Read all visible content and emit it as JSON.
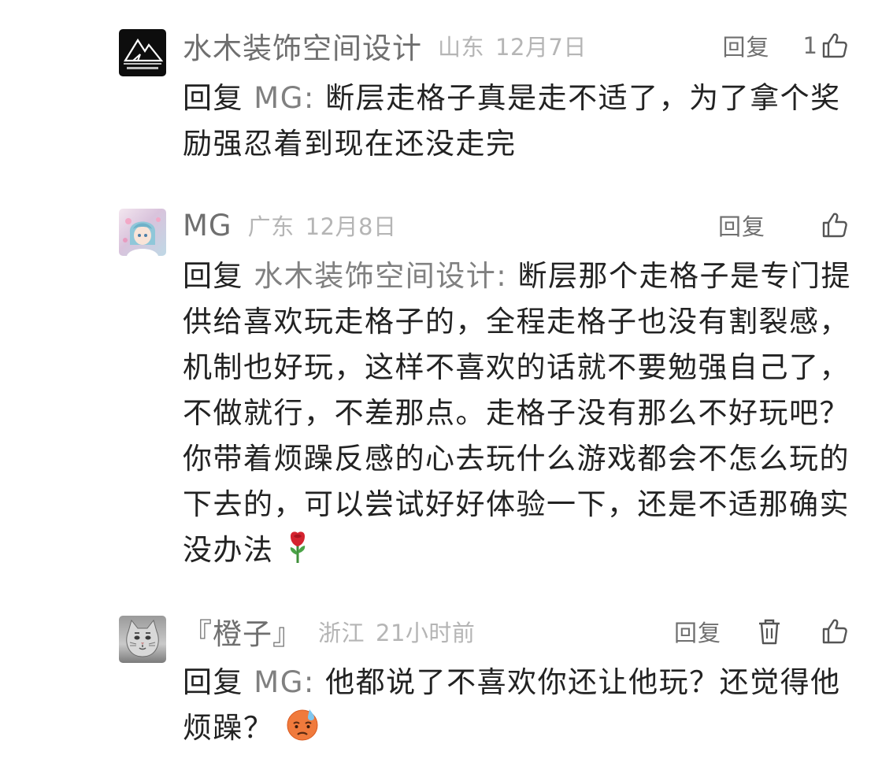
{
  "comments": [
    {
      "author": "水木装饰空间设计",
      "region": "山东",
      "date": "12月7日",
      "reply_label": "回复",
      "like_count": "1",
      "avatar_icon": "logo-avatar-icon",
      "reply_prefix": "回复",
      "reply_target": "MG:",
      "text": "断层走格子真是走不适了，为了拿个奖励强忍着到现在还没走完"
    },
    {
      "author": "MG",
      "region": "广东",
      "date": "12月8日",
      "reply_label": "回复",
      "like_count": "",
      "avatar_icon": "anime-avatar-icon",
      "reply_prefix": "回复",
      "reply_target": "水木装饰空间设计:",
      "text": "断层那个走格子是专门提供给喜欢玩走格子的，全程走格子也没有割裂感，机制也好玩，这样不喜欢的话就不要勉强自己了，不做就行，不差那点。走格子没有那么不好玩吧？你带着烦躁反感的心去玩什么游戏都会不怎么玩的下去的，可以尝试好好体验一下，还是不适那确实没办法",
      "emoji": "rose-emoji"
    },
    {
      "author": "『橙子』",
      "region": "浙江",
      "date": "21小时前",
      "reply_label": "回复",
      "like_count": "",
      "avatar_icon": "cat-avatar-icon",
      "reply_prefix": "回复",
      "reply_target": "MG:",
      "text": "他都说了不喜欢你还让他玩？还觉得他烦躁？",
      "emoji": "sweat-face-emoji"
    }
  ],
  "icons": {
    "like": "thumbs-up-icon",
    "delete": "trash-icon"
  },
  "colors": {
    "name": "#6f6f6f",
    "meta": "#b5b5b5",
    "body": "#222222",
    "target": "#808080"
  }
}
